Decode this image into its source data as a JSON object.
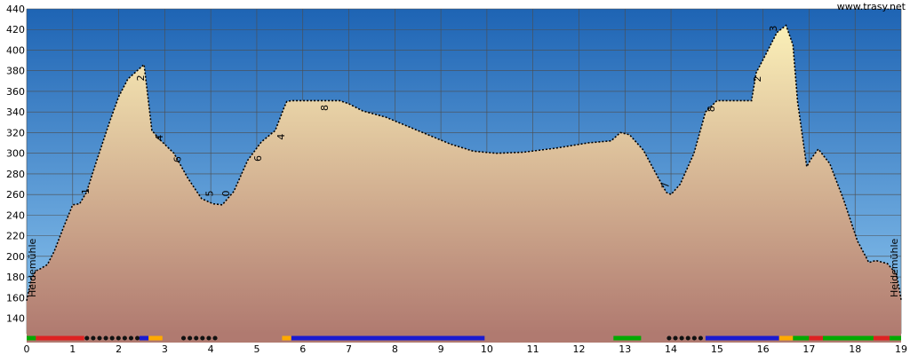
{
  "site_credit": "www.trasy.net",
  "chart_data": {
    "type": "area",
    "title": "",
    "xlabel": "",
    "ylabel": "",
    "xlim": [
      0,
      19
    ],
    "ylim": [
      125,
      440
    ],
    "x_ticks": [
      "0",
      "1",
      "2",
      "3",
      "4",
      "5",
      "6",
      "7",
      "8",
      "9",
      "10",
      "11",
      "12",
      "13",
      "14",
      "15",
      "16",
      "17",
      "18",
      "19"
    ],
    "y_ticks": [
      "140",
      "160",
      "180",
      "200",
      "220",
      "240",
      "260",
      "280",
      "300",
      "320",
      "340",
      "360",
      "380",
      "400",
      "420",
      "440"
    ],
    "grid": true,
    "series": [
      {
        "x": [
          0,
          0.1,
          0.2,
          0.3,
          0.45,
          0.6,
          0.8,
          1.0,
          1.15,
          1.3,
          1.5,
          1.8,
          2.0,
          2.2,
          2.4,
          2.55,
          2.62,
          2.72,
          2.9,
          3.2,
          3.5,
          3.8,
          4.05,
          4.25,
          4.5,
          4.8,
          5.1,
          5.4,
          5.6,
          5.65,
          5.75,
          6.0,
          6.5,
          6.8,
          7.0,
          7.3,
          7.8,
          8.5,
          9.2,
          9.7,
          10.2,
          10.8,
          11.5,
          12.2,
          12.7,
          12.9,
          13.1,
          13.4,
          13.7,
          13.9,
          14.0,
          14.2,
          14.5,
          14.75,
          15.0,
          15.5,
          15.75,
          15.85,
          16.05,
          16.3,
          16.5,
          16.65,
          16.75,
          16.95,
          17.05,
          17.2,
          17.45,
          17.75,
          18.05,
          18.3,
          18.45,
          18.7,
          18.9,
          19.0
        ],
        "y": [
          157,
          178,
          186,
          188,
          192,
          205,
          228,
          250,
          251,
          262,
          290,
          330,
          355,
          372,
          380,
          386,
          360,
          322,
          313,
          300,
          276,
          256,
          251,
          250,
          263,
          293,
          311,
          322,
          345,
          350,
          351,
          351,
          351,
          351,
          348,
          341,
          335,
          322,
          309,
          302,
          300,
          301,
          305,
          310,
          312,
          320,
          318,
          303,
          278,
          262,
          260,
          270,
          300,
          340,
          351,
          351,
          351,
          378,
          395,
          417,
          424,
          405,
          350,
          287,
          295,
          304,
          290,
          255,
          215,
          194,
          196,
          193,
          183,
          158
        ]
      }
    ],
    "waypoint_labels": [
      {
        "text": "1",
        "x": 1.35,
        "y": 260
      },
      {
        "text": "2",
        "x": 2.55,
        "y": 370
      },
      {
        "text": "4",
        "x": 2.95,
        "y": 312
      },
      {
        "text": "6",
        "x": 3.35,
        "y": 291
      },
      {
        "text": "5",
        "x": 4.05,
        "y": 258
      },
      {
        "text": "0",
        "x": 4.4,
        "y": 258
      },
      {
        "text": "6",
        "x": 5.1,
        "y": 292
      },
      {
        "text": "4",
        "x": 5.6,
        "y": 313
      },
      {
        "text": "8",
        "x": 6.55,
        "y": 341
      },
      {
        "text": "7",
        "x": 13.95,
        "y": 266
      },
      {
        "text": "8",
        "x": 14.95,
        "y": 340
      },
      {
        "text": "2",
        "x": 15.95,
        "y": 369
      },
      {
        "text": "3",
        "x": 16.3,
        "y": 418
      }
    ],
    "endpoint_labels": {
      "start": "Heidemühle",
      "end": "Heidemühle"
    },
    "surface_segments": [
      {
        "from": 0.0,
        "to": 0.2,
        "color": "#00aa00"
      },
      {
        "from": 0.2,
        "to": 1.25,
        "color": "#dd2222"
      },
      {
        "from": 1.25,
        "to": 2.45,
        "color": "#111111",
        "dashed": true
      },
      {
        "from": 2.45,
        "to": 2.65,
        "color": "#1a1ad0"
      },
      {
        "from": 2.65,
        "to": 2.95,
        "color": "#ffaa00"
      },
      {
        "from": 3.35,
        "to": 4.15,
        "color": "#111111",
        "dashed": true
      },
      {
        "from": 5.55,
        "to": 5.75,
        "color": "#ffaa00"
      },
      {
        "from": 5.75,
        "to": 9.95,
        "color": "#1a1ad0"
      },
      {
        "from": 12.75,
        "to": 13.35,
        "color": "#00aa00"
      },
      {
        "from": 13.9,
        "to": 14.75,
        "color": "#111111",
        "dashed": true
      },
      {
        "from": 14.75,
        "to": 16.35,
        "color": "#1a1ad0"
      },
      {
        "from": 16.35,
        "to": 16.65,
        "color": "#ffaa00"
      },
      {
        "from": 16.65,
        "to": 17.0,
        "color": "#00aa00"
      },
      {
        "from": 17.0,
        "to": 17.3,
        "color": "#dd2222"
      },
      {
        "from": 17.3,
        "to": 18.4,
        "color": "#00aa00"
      },
      {
        "from": 18.4,
        "to": 18.75,
        "color": "#dd2222"
      },
      {
        "from": 18.75,
        "to": 19.0,
        "color": "#00aa00"
      }
    ],
    "colors": {
      "sky_top": "#1e64b4",
      "sky_bottom": "#8ec7f0",
      "fill_top": "#fbf0b8",
      "fill_bottom": "#b07a70",
      "grid": "#4d4d4d"
    }
  }
}
